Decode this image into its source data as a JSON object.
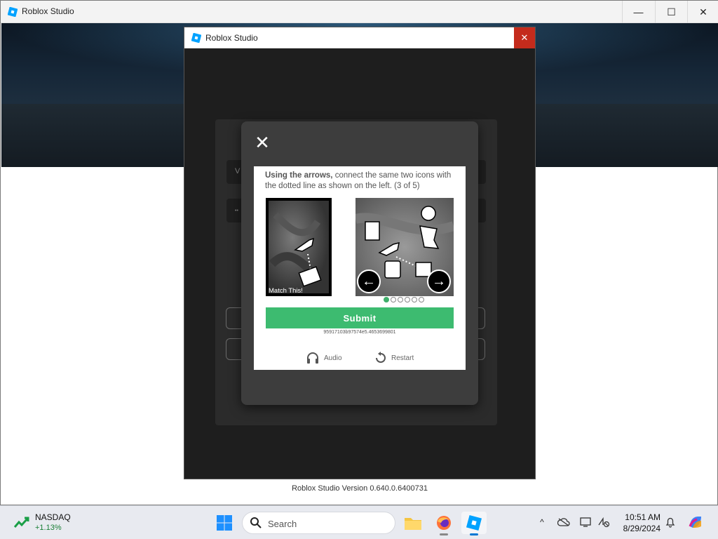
{
  "main_window": {
    "title": "Roblox Studio",
    "icon": "roblox-studio-icon",
    "controls": {
      "minimize": "—",
      "maximize": "☐",
      "close": "✕"
    }
  },
  "version": "Roblox Studio Version 0.640.0.6400731",
  "dialog": {
    "title": "Roblox Studio",
    "close": "✕"
  },
  "login": {
    "field1_placeholder": "V",
    "field2_placeholder": "••"
  },
  "captcha": {
    "close": "✕",
    "instruction_bold": "Using the arrows,",
    "instruction_rest": " connect the same two icons with the dotted line as shown on the left. (3 of 5)",
    "match_label": "Match This!",
    "prev_arrow": "←",
    "next_arrow": "→",
    "dots_total": 6,
    "dots_active": 1,
    "submit_label": "Submit",
    "session_id": "95917103b97574e5.4653699801",
    "audio_label": "Audio",
    "restart_label": "Restart"
  },
  "taskbar": {
    "stock_name": "NASDAQ",
    "stock_change": "+1.13%",
    "search_placeholder": "Search",
    "time": "10:51 AM",
    "date": "8/29/2024",
    "apps": [
      "file-explorer-icon",
      "firefox-icon",
      "roblox-studio-icon"
    ],
    "tray": [
      "chevron-up-icon",
      "onedrive-icon",
      "display-icon",
      "network-icon",
      "bell-icon",
      "copilot-icon"
    ]
  },
  "colors": {
    "submit": "#3dbb70",
    "close_red": "#c42b1c",
    "stock_green": "#1a7f37",
    "roblox_blue": "#00a2ff"
  }
}
